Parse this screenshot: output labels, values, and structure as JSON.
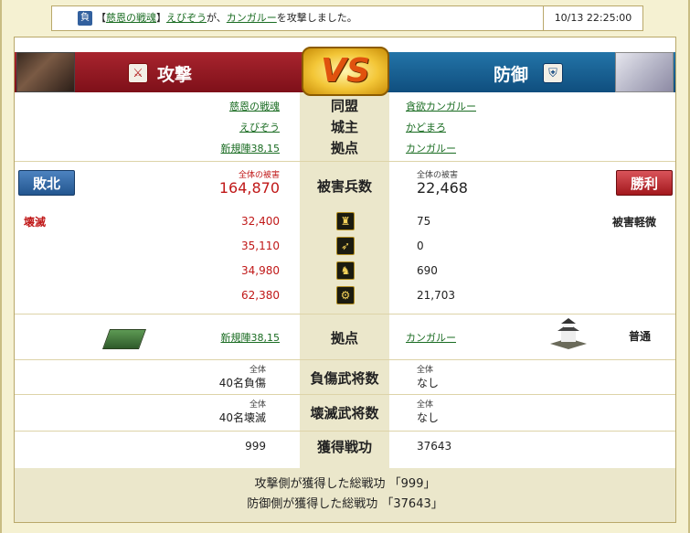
{
  "notice": {
    "badge": "負",
    "bracket_open": "【",
    "alliance": "慈恩の戦魂",
    "bracket_close": "】",
    "player": "えびぞう",
    "mid": "が、",
    "target": "カンガルー",
    "suffix": "を攻撃しました。",
    "datetime": "10/13 22:25:00"
  },
  "header": {
    "attack_label": "攻撃",
    "defense_label": "防御",
    "vs_label": "VS"
  },
  "info": {
    "alliance_label": "同盟",
    "lord_label": "城主",
    "base_label": "拠点",
    "attacker": {
      "alliance": "慈恩の戦魂",
      "lord": "えびぞう",
      "base": "新規陣38,15"
    },
    "defender": {
      "alliance": "貪欲カンガルー",
      "lord": "かどまろ",
      "base": "カンガルー"
    }
  },
  "damage": {
    "label": "被害兵数",
    "total_small_label": "全体の被害",
    "attacker_total": "164,870",
    "defender_total": "22,468",
    "attacker_result": "敗北",
    "defender_result": "勝利",
    "attacker_status": "壊滅",
    "defender_status": "被害軽微",
    "rows": [
      {
        "icon": "spear-infantry-icon",
        "attacker": "32,400",
        "defender": "75"
      },
      {
        "icon": "bow-icon",
        "attacker": "35,110",
        "defender": "0"
      },
      {
        "icon": "horse-icon",
        "attacker": "34,980",
        "defender": "690"
      },
      {
        "icon": "siege-weapon-icon",
        "attacker": "62,380",
        "defender": "21,703"
      }
    ]
  },
  "base_row": {
    "label": "拠点",
    "attacker_base": "新規陣38,15",
    "defender_base": "カンガルー",
    "defender_status": "普通"
  },
  "wounded": {
    "label": "負傷武将数",
    "small_label": "全体",
    "attacker": "40名負傷",
    "defender": "なし"
  },
  "destroyed": {
    "label": "壊滅武将数",
    "small_label": "全体",
    "attacker": "40名壊滅",
    "defender": "なし"
  },
  "merit": {
    "label": "獲得戦功",
    "attacker": "999",
    "defender": "37643"
  },
  "footer": {
    "line1": "攻撃側が獲得した総戦功 「999」",
    "line2": "防御側が獲得した総戦功 「37643」"
  }
}
